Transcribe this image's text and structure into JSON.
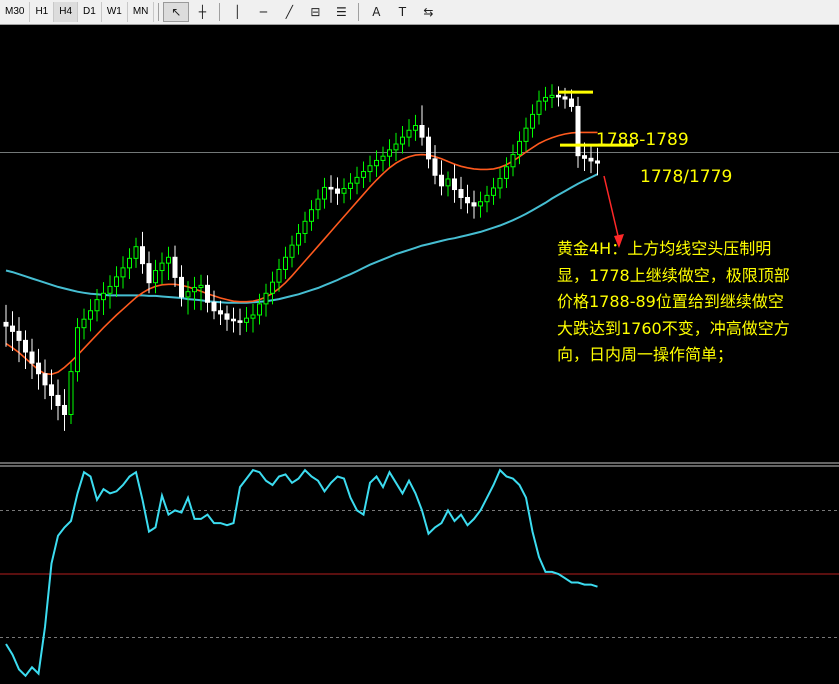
{
  "toolbar": {
    "timeframes": [
      "M30",
      "H1",
      "H4",
      "D1",
      "W1",
      "MN"
    ],
    "active_timeframe": "H4",
    "tools": [
      {
        "name": "cursor-icon",
        "glyph": "↖"
      },
      {
        "name": "crosshair-icon",
        "glyph": "┼"
      },
      {
        "name": "vertical-line-icon",
        "glyph": "│"
      },
      {
        "name": "horizontal-line-icon",
        "glyph": "─"
      },
      {
        "name": "trendline-icon",
        "glyph": "╱"
      },
      {
        "name": "equidistant-channel-icon",
        "glyph": "⊟"
      },
      {
        "name": "fibonacci-icon",
        "glyph": "☰"
      },
      {
        "name": "text-icon",
        "glyph": "A"
      },
      {
        "name": "text-label-icon",
        "glyph": "T"
      },
      {
        "name": "arrows-icon",
        "glyph": "⇆"
      }
    ]
  },
  "annotations": {
    "level_high": "1788-1789",
    "level_low": "1778/1779",
    "note_lines": [
      "黄金4H：上方均线空头压制明",
      "显，1778上继续做空，极限顶部",
      "价格1788-89位置给到继续做空",
      "大跌达到1760不变，冲高做空方",
      "向，日内周一操作简单；"
    ]
  },
  "colors": {
    "background": "#000000",
    "candle_up": "#00ff00",
    "candle_down": "#ffffff",
    "ma_fast": "#ff5a1e",
    "ma_slow": "#46bed2",
    "oscillator": "#3cdcf0",
    "annotation": "#ffff00",
    "arrow": "#ff2828",
    "reference_line": "#9aa0a0"
  },
  "chart_data": [
    {
      "type": "candlestick",
      "symbol": "Gold",
      "timeframe": "H4",
      "unit": "approximate price (read from annotated levels)",
      "ylim": [
        1719,
        1801
      ],
      "candles": [
        [
          1745.0,
          1748.3,
          1740.4,
          1744.3
        ],
        [
          1744.3,
          1747.1,
          1739.6,
          1743.3
        ],
        [
          1743.3,
          1746.0,
          1737.5,
          1741.6
        ],
        [
          1741.6,
          1743.5,
          1736.2,
          1739.4
        ],
        [
          1739.4,
          1741.9,
          1734.3,
          1737.3
        ],
        [
          1737.3,
          1740.0,
          1732.3,
          1735.3
        ],
        [
          1735.3,
          1738.0,
          1730.5,
          1733.2
        ],
        [
          1733.2,
          1736.1,
          1728.5,
          1731.2
        ],
        [
          1731.2,
          1734.2,
          1726.5,
          1729.3
        ],
        [
          1729.3,
          1732.4,
          1724.5,
          1727.6
        ],
        [
          1727.6,
          1737.5,
          1725.8,
          1735.7
        ],
        [
          1735.7,
          1745.8,
          1733.8,
          1744.0
        ],
        [
          1744.0,
          1747.6,
          1741.8,
          1745.6
        ],
        [
          1745.6,
          1749.4,
          1743.3,
          1747.2
        ],
        [
          1747.2,
          1751.3,
          1745.2,
          1749.3
        ],
        [
          1749.3,
          1752.6,
          1746.4,
          1750.5
        ],
        [
          1750.5,
          1753.9,
          1747.6,
          1751.8
        ],
        [
          1751.8,
          1755.6,
          1749.8,
          1753.6
        ],
        [
          1753.6,
          1757.5,
          1751.4,
          1755.3
        ],
        [
          1755.3,
          1759.0,
          1753.2,
          1757.1
        ],
        [
          1757.1,
          1761.0,
          1755.3,
          1759.3
        ],
        [
          1759.3,
          1762.1,
          1754.2,
          1756.1
        ],
        [
          1756.1,
          1758.4,
          1750.5,
          1752.5
        ],
        [
          1752.5,
          1756.8,
          1750.5,
          1754.8
        ],
        [
          1754.8,
          1758.2,
          1752.2,
          1756.2
        ],
        [
          1756.2,
          1759.3,
          1753.0,
          1757.3
        ],
        [
          1757.3,
          1759.5,
          1751.7,
          1753.5
        ],
        [
          1753.5,
          1755.8,
          1748.0,
          1749.8
        ],
        [
          1749.8,
          1752.8,
          1746.5,
          1750.8
        ],
        [
          1750.8,
          1753.6,
          1747.4,
          1751.6
        ],
        [
          1751.6,
          1754.0,
          1747.3,
          1752.0
        ],
        [
          1752.0,
          1753.9,
          1746.9,
          1748.8
        ],
        [
          1748.8,
          1751.0,
          1745.6,
          1747.2
        ],
        [
          1747.2,
          1749.1,
          1744.5,
          1746.6
        ],
        [
          1746.6,
          1748.2,
          1743.4,
          1745.6
        ],
        [
          1745.6,
          1747.8,
          1743.1,
          1745.3
        ],
        [
          1745.3,
          1747.6,
          1742.6,
          1745.0
        ],
        [
          1745.0,
          1747.9,
          1743.2,
          1745.8
        ],
        [
          1745.8,
          1748.5,
          1743.1,
          1746.4
        ],
        [
          1746.4,
          1750.4,
          1744.6,
          1748.5
        ],
        [
          1748.5,
          1752.3,
          1746.1,
          1750.5
        ],
        [
          1750.5,
          1754.6,
          1748.4,
          1752.6
        ],
        [
          1752.6,
          1757.0,
          1750.8,
          1755.0
        ],
        [
          1755.0,
          1759.3,
          1753.2,
          1757.3
        ],
        [
          1757.3,
          1761.4,
          1755.4,
          1759.6
        ],
        [
          1759.6,
          1763.6,
          1757.8,
          1761.8
        ],
        [
          1761.8,
          1765.9,
          1760.0,
          1764.1
        ],
        [
          1764.1,
          1768.1,
          1762.3,
          1766.3
        ],
        [
          1766.3,
          1770.1,
          1764.5,
          1768.3
        ],
        [
          1768.3,
          1772.3,
          1766.5,
          1770.5
        ],
        [
          1770.5,
          1772.8,
          1767.6,
          1770.2
        ],
        [
          1770.2,
          1772.4,
          1767.2,
          1769.4
        ],
        [
          1769.4,
          1772.2,
          1767.5,
          1770.3
        ],
        [
          1770.3,
          1773.2,
          1768.2,
          1771.3
        ],
        [
          1771.3,
          1774.4,
          1769.2,
          1772.4
        ],
        [
          1772.4,
          1775.4,
          1770.4,
          1773.5
        ],
        [
          1773.5,
          1776.5,
          1771.5,
          1774.6
        ],
        [
          1774.6,
          1777.5,
          1772.5,
          1775.6
        ],
        [
          1775.6,
          1778.2,
          1773.5,
          1776.4
        ],
        [
          1776.4,
          1779.6,
          1774.4,
          1777.6
        ],
        [
          1777.6,
          1780.8,
          1775.5,
          1778.7
        ],
        [
          1778.7,
          1782.1,
          1776.9,
          1780.0
        ],
        [
          1780.0,
          1783.4,
          1778.2,
          1781.3
        ],
        [
          1781.3,
          1784.2,
          1779.3,
          1782.2
        ],
        [
          1782.2,
          1786.0,
          1778.4,
          1780.0
        ],
        [
          1780.0,
          1781.8,
          1774.1,
          1775.9
        ],
        [
          1775.9,
          1778.5,
          1771.1,
          1772.8
        ],
        [
          1772.8,
          1775.6,
          1769.0,
          1770.8
        ],
        [
          1770.8,
          1773.5,
          1768.8,
          1772.1
        ],
        [
          1772.1,
          1774.8,
          1767.6,
          1770.1
        ],
        [
          1770.1,
          1772.5,
          1766.4,
          1768.6
        ],
        [
          1768.6,
          1771.0,
          1765.6,
          1767.6
        ],
        [
          1767.6,
          1769.9,
          1764.6,
          1767.0
        ],
        [
          1767.0,
          1769.7,
          1764.8,
          1767.8
        ],
        [
          1767.8,
          1770.8,
          1765.8,
          1769.0
        ],
        [
          1769.0,
          1772.3,
          1767.2,
          1770.4
        ],
        [
          1770.4,
          1774.1,
          1768.4,
          1772.2
        ],
        [
          1772.2,
          1776.2,
          1770.4,
          1774.4
        ],
        [
          1774.4,
          1778.6,
          1772.6,
          1776.7
        ],
        [
          1776.7,
          1781.1,
          1774.9,
          1779.2
        ],
        [
          1779.2,
          1783.7,
          1777.3,
          1781.7
        ],
        [
          1781.7,
          1786.2,
          1779.9,
          1784.3
        ],
        [
          1784.3,
          1788.8,
          1782.4,
          1786.8
        ],
        [
          1786.8,
          1789.5,
          1785.0,
          1787.5
        ],
        [
          1787.5,
          1790.0,
          1785.5,
          1787.9
        ],
        [
          1787.9,
          1789.6,
          1785.8,
          1787.6
        ],
        [
          1787.6,
          1789.3,
          1785.4,
          1787.2
        ],
        [
          1787.2,
          1789.0,
          1784.8,
          1785.8
        ],
        [
          1785.8,
          1787.6,
          1774.2,
          1776.5
        ],
        [
          1776.5,
          1779.0,
          1773.6,
          1776.0
        ],
        [
          1776.0,
          1778.5,
          1773.2,
          1775.5
        ],
        [
          1775.5,
          1778.0,
          1772.8,
          1775.1
        ]
      ],
      "ma_fast": [
        1741.0,
        1740.2,
        1739.3,
        1738.2,
        1737.1,
        1736.0,
        1735.3,
        1735.2,
        1735.6,
        1736.5,
        1737.6,
        1738.8,
        1740.1,
        1741.4,
        1742.7,
        1744.0,
        1745.2,
        1746.4,
        1747.5,
        1748.6,
        1749.7,
        1750.6,
        1751.3,
        1751.8,
        1752.1,
        1752.2,
        1752.2,
        1752.0,
        1751.7,
        1751.3,
        1750.9,
        1750.4,
        1750.0,
        1749.6,
        1749.3,
        1749.0,
        1748.9,
        1748.9,
        1749.0,
        1749.3,
        1749.8,
        1750.5,
        1751.4,
        1752.5,
        1753.8,
        1755.2,
        1756.6,
        1758.0,
        1759.4,
        1760.8,
        1762.2,
        1763.6,
        1765.0,
        1766.4,
        1767.8,
        1769.2,
        1770.6,
        1771.9,
        1773.1,
        1774.2,
        1775.1,
        1775.8,
        1776.3,
        1776.6,
        1776.7,
        1776.6,
        1776.3,
        1775.9,
        1775.4,
        1774.9,
        1774.5,
        1774.2,
        1774.0,
        1773.9,
        1773.9,
        1774.0,
        1774.3,
        1774.8,
        1775.5,
        1776.3,
        1777.2,
        1778.0,
        1778.8,
        1779.4,
        1779.9,
        1780.3,
        1780.6,
        1780.8,
        1780.9,
        1780.9,
        1780.9,
        1780.9
      ],
      "ma_slow": [
        1754.8,
        1754.5,
        1754.1,
        1753.7,
        1753.3,
        1752.9,
        1752.5,
        1752.1,
        1751.7,
        1751.4,
        1751.1,
        1750.8,
        1750.6,
        1750.4,
        1750.3,
        1750.2,
        1750.1,
        1750.1,
        1750.1,
        1750.1,
        1750.1,
        1750.1,
        1750.0,
        1750.0,
        1749.9,
        1749.8,
        1749.7,
        1749.6,
        1749.4,
        1749.3,
        1749.2,
        1749.0,
        1748.9,
        1748.8,
        1748.7,
        1748.7,
        1748.7,
        1748.7,
        1748.8,
        1748.9,
        1749.0,
        1749.2,
        1749.4,
        1749.7,
        1750.0,
        1750.3,
        1750.7,
        1751.1,
        1751.5,
        1752.0,
        1752.5,
        1753.0,
        1753.6,
        1754.1,
        1754.7,
        1755.3,
        1755.9,
        1756.4,
        1756.9,
        1757.4,
        1757.9,
        1758.3,
        1758.7,
        1759.1,
        1759.5,
        1759.8,
        1760.1,
        1760.4,
        1760.7,
        1760.9,
        1761.2,
        1761.5,
        1761.8,
        1762.1,
        1762.5,
        1762.9,
        1763.3,
        1763.8,
        1764.3,
        1764.9,
        1765.5,
        1766.2,
        1766.9,
        1767.6,
        1768.4,
        1769.1,
        1769.8,
        1770.5,
        1771.2,
        1771.8,
        1772.4,
        1773.0
      ],
      "levels": [
        {
          "label": "1788-1789",
          "value": 1788.5
        },
        {
          "label": "1778/1779",
          "value": 1778.5
        }
      ],
      "reference_line": 1777.1
    },
    {
      "type": "line",
      "panel": "oscillator",
      "ylim": [
        0,
        100
      ],
      "levels": [
        80,
        50,
        20
      ],
      "values": [
        17,
        12,
        5,
        2,
        6,
        3,
        25,
        55,
        68,
        72,
        75,
        88,
        98,
        96,
        85,
        90,
        88,
        89,
        92,
        96,
        98,
        85,
        70,
        72,
        87,
        78,
        80,
        79,
        86,
        76,
        76,
        78,
        74,
        74,
        73,
        74,
        91,
        95,
        99,
        98,
        94,
        92,
        96,
        97,
        93,
        95,
        99,
        96,
        94,
        89,
        93,
        96,
        95,
        86,
        80,
        78,
        93,
        96,
        91,
        98,
        93,
        88,
        94,
        88,
        80,
        69,
        72,
        74,
        80,
        75,
        78,
        73,
        76,
        80,
        86,
        92,
        99,
        96,
        95,
        92,
        86,
        70,
        58,
        51,
        51,
        50,
        48,
        46,
        46,
        45,
        45,
        44
      ]
    }
  ]
}
